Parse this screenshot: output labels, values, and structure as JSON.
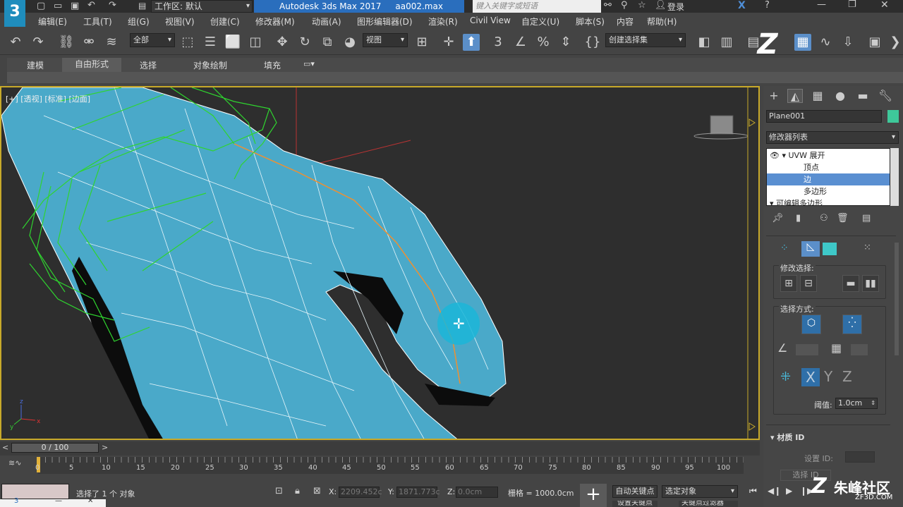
{
  "titlebar": {
    "workspace_label": "工作区: 默认",
    "app_title": "Autodesk 3ds Max 2017",
    "file_name": "aa002.max",
    "search_placeholder": "键入关键字或短语",
    "login": "登录"
  },
  "menubar": [
    "编辑(E)",
    "工具(T)",
    "组(G)",
    "视图(V)",
    "创建(C)",
    "修改器(M)",
    "动画(A)",
    "图形编辑器(D)",
    "渲染(R)",
    "Civil View",
    "自定义(U)",
    "脚本(S)",
    "内容",
    "帮助(H)"
  ],
  "toolbar": {
    "filter_value": "全部",
    "refcoord_value": "视图",
    "selset_value": "创建选择集"
  },
  "ribbon": {
    "tabs": [
      "建模",
      "自由形式",
      "选择",
      "对象绘制",
      "填充"
    ],
    "active_tab": "自由形式"
  },
  "viewport": {
    "label": "[+] [透视] [标准] [边面]",
    "axis_labels": {
      "x": "x",
      "y": "y",
      "z": "z"
    },
    "colors": {
      "mesh": "#4aa9c9",
      "wireframe": "#2fd42f",
      "border": "#c8a92a",
      "background": "#2e2e2e"
    }
  },
  "command_panel": {
    "object_name": "Plane001",
    "object_color": "#3ec89a",
    "modifier_list": "修改器列表",
    "stack": [
      {
        "label": "UVW 展开",
        "level": 0
      },
      {
        "label": "顶点",
        "level": 1
      },
      {
        "label": "边",
        "level": 1,
        "selected": true
      },
      {
        "label": "多边形",
        "level": 1
      },
      {
        "label": "可编辑多边形",
        "level": 0
      }
    ],
    "modify_selection": "修改选择:",
    "selection_method": "选择方式:",
    "y_label": "Y",
    "z_label": "Z",
    "threshold_label": "阈值:",
    "threshold_value": "1.0cm",
    "material_id_section": "材质 ID",
    "set_id_label": "设置 ID:",
    "select_id_label": "选择 ID"
  },
  "timeline": {
    "slider": "0 / 100",
    "ticks": [
      "0",
      "5",
      "10",
      "15",
      "20",
      "25",
      "30",
      "35",
      "40",
      "45",
      "50",
      "55",
      "60",
      "65",
      "70",
      "75",
      "80",
      "85",
      "90",
      "95",
      "100"
    ]
  },
  "status": {
    "message": "选择了 1 个 对象",
    "x_label": "X:",
    "x_value": "2209.452c",
    "y_label": "Y:",
    "y_value": "1871.773c",
    "z_label": "Z:",
    "z_value": "0.0cm",
    "grid": "栅格 = 1000.0cm",
    "auto_key": "自动关键点",
    "selected_object": "选定对象",
    "set_key": "设置关键点",
    "key_filter": "关键点过滤器"
  },
  "watermark": {
    "text": "朱峰社区",
    "sub": "ZF3D.COM"
  }
}
